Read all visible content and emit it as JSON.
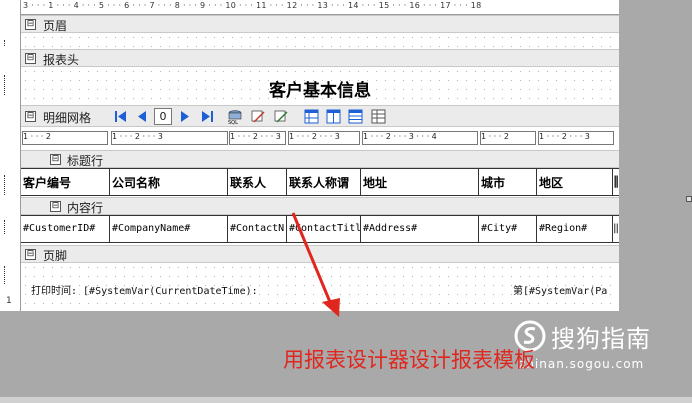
{
  "ruler_top": "3 · · · 1 · · · 4 · · · 5 · · · 6 · · · 7 · · · 8 · · · 9 · · · 10 · · · 11 · · · 12 · · · 13 · · · 14 · · · 15 · · · 16 · · · 17 · · · 18",
  "ruler_left_number": "1",
  "bands": {
    "page_header": "页眉",
    "report_header": "报表头",
    "detail_grid": "明细网格",
    "title_row": "标题行",
    "content_row": "内容行",
    "page_footer": "页脚"
  },
  "toggle_glyph": "⊟",
  "report_title": "客户基本信息",
  "pager": {
    "page": "0"
  },
  "subruler_segments": [
    "1 · · · 2",
    "1 · · · 2 · · · 3",
    "1 · · · 2 · · · 3",
    "1 · · · 2 · · · 3",
    "1 · · · 2 · · · 3 · · · 4",
    "1 · · · 2",
    "1 · · · 2 · · · 3"
  ],
  "header_cells": [
    "客户编号",
    "公司名称",
    "联系人",
    "联系人称谓",
    "地址",
    "城市",
    "地区",
    "‖"
  ],
  "data_cells": [
    "#CustomerID#",
    "#CompanyName#",
    "#ContactN",
    "#ContactTitl",
    "#Address#",
    "#City#",
    "#Region#",
    "‖"
  ],
  "footer": {
    "print_time": "打印时间: [#SystemVar(CurrentDateTime):",
    "page_number": "第[#SystemVar(Pa"
  },
  "watermark": {
    "brand": "搜狗指南",
    "url": "zhinan.sogou.com"
  },
  "caption": "用报表设计器设计报表模板",
  "colors": {
    "annotation_red": "#e0271f",
    "toolbar_blue": "#1f5fd6",
    "background_gray": "#a9a9a9"
  }
}
